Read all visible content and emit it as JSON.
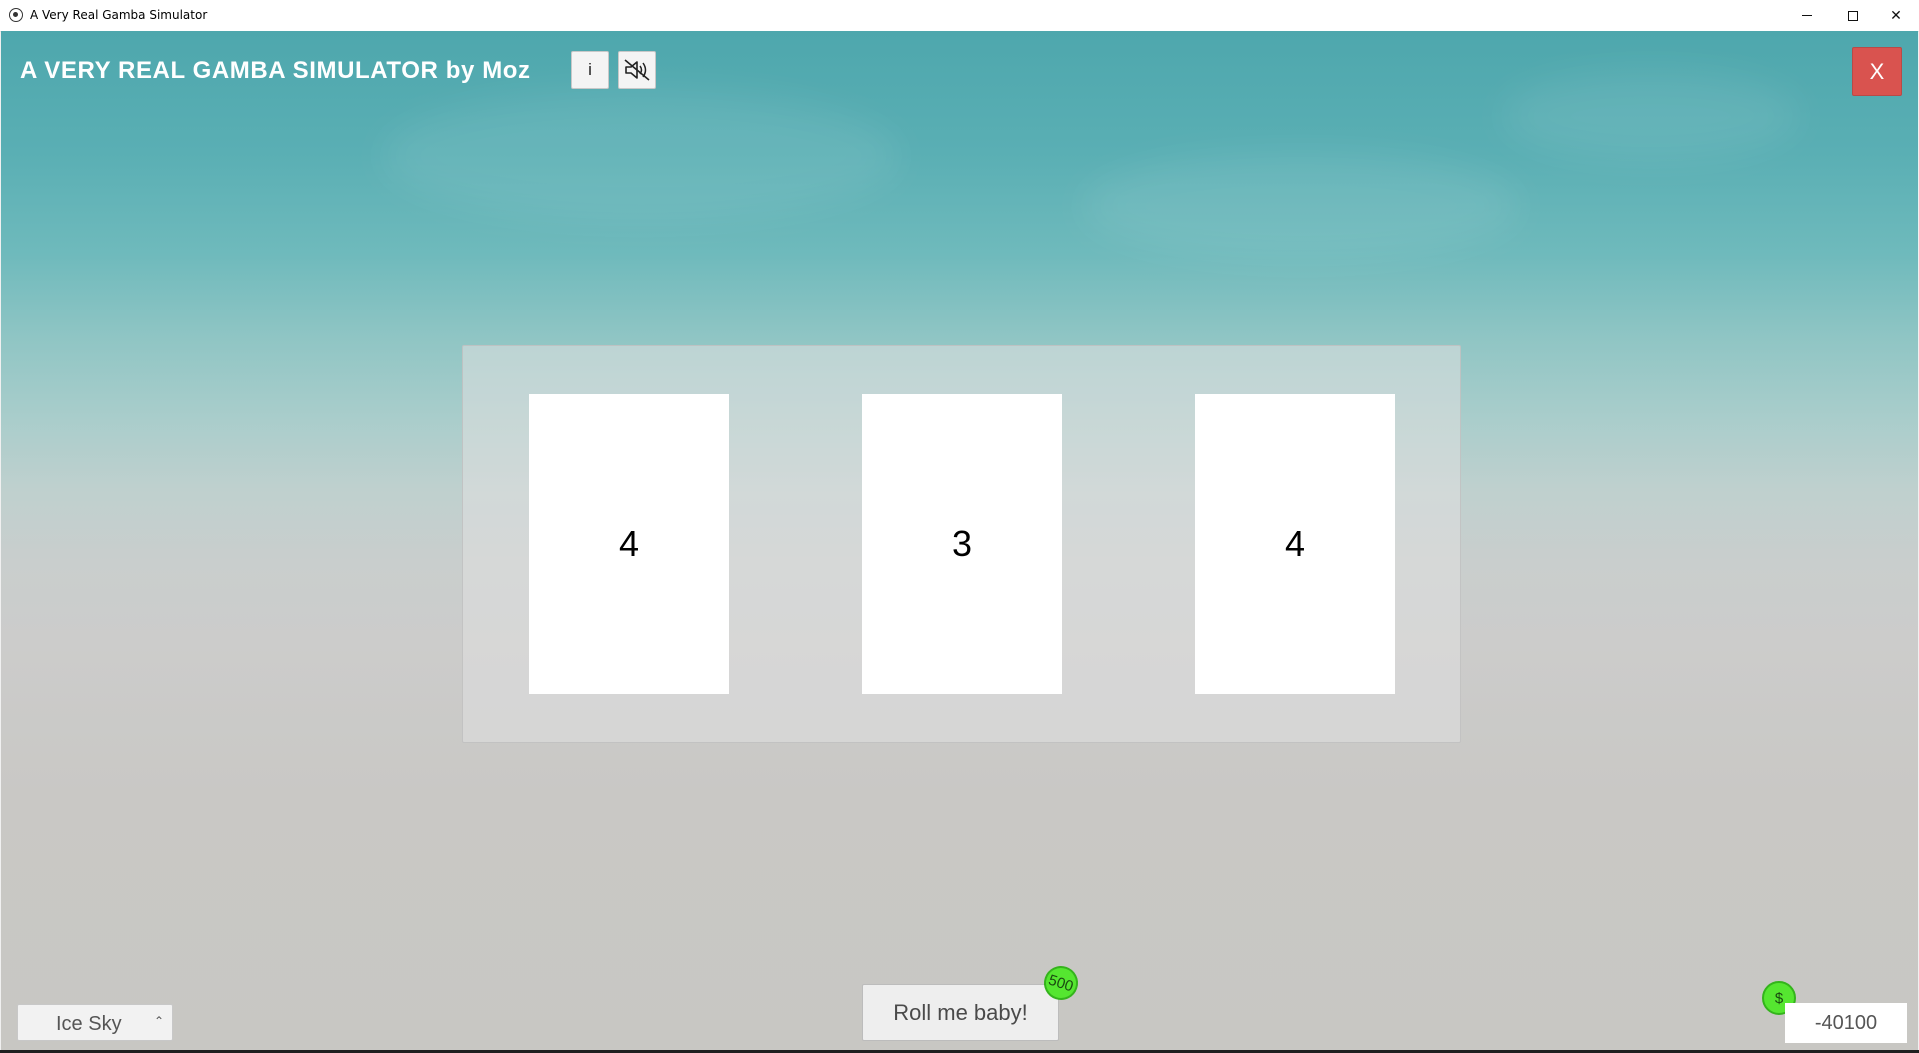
{
  "window": {
    "title": "A Very Real Gamba Simulator"
  },
  "header": {
    "title": "A VERY REAL GAMBA SIMULATOR by Moz",
    "info_label": "i",
    "mute_icon": "speaker-muted-icon",
    "close_label": "X"
  },
  "reels": [
    {
      "value": "4"
    },
    {
      "value": "3"
    },
    {
      "value": "4"
    }
  ],
  "theme": {
    "selected": "Ice Sky",
    "caret": "^"
  },
  "roll": {
    "label": "Roll me baby!",
    "cost": "500"
  },
  "balance": {
    "currency_symbol": "$",
    "amount": "-40100"
  },
  "colors": {
    "badge_green": "#55e630",
    "close_red": "#d9534f"
  }
}
